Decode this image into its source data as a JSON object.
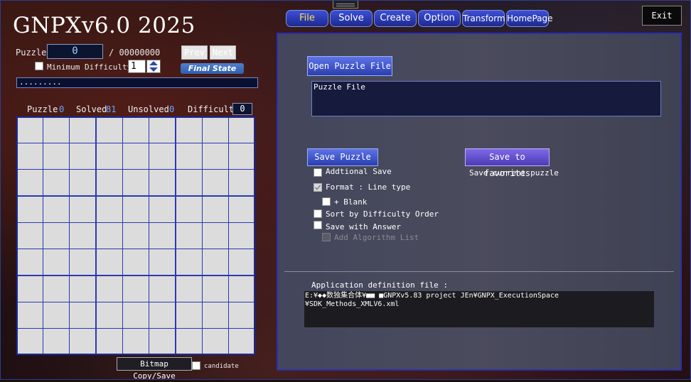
{
  "app": {
    "title": "GNPXv6.0 2025"
  },
  "menu": {
    "tabs": [
      "File",
      "Solve",
      "Create",
      "Option",
      "Transform",
      "HomePage"
    ],
    "exit_label": "Exit"
  },
  "left": {
    "puzzle_label": "Puzzle",
    "puzzle_number": "0",
    "puzzle_total": "/ 00000000",
    "prev_label": "Prev",
    "next_label": "Next",
    "min_difficulty_label": "Minimum Difficulty",
    "min_difficulty_value": "1",
    "final_state_label": "Final State",
    "progress_text": ".........",
    "stats": {
      "puzzle_label": "Puzzle",
      "puzzle_value": "0",
      "solved_label": "Solved",
      "solved_value": "81",
      "unsolved_label": "Unsolved",
      "unsolved_value": "0",
      "difficulty_label": "Difficulty",
      "difficulty_value": "0"
    },
    "bitmap_button": "Bitmap Copy/Save",
    "candidate_label": "candidate"
  },
  "file_panel": {
    "open_button": "Open Puzzle File",
    "puzzle_file_text": "Puzzle File",
    "save_button": "Save Puzzle",
    "favorites_button": "Save to favorites",
    "favorites_desc": "Save current puzzle",
    "options": [
      {
        "label": "Addtional Save",
        "checked": false,
        "disabled": false
      },
      {
        "label": "Format : Line type",
        "checked": true,
        "disabled": true
      },
      {
        "label": "+ Blank",
        "checked": false,
        "disabled": false
      },
      {
        "label": "Sort by Difficulty Order",
        "checked": false,
        "disabled": false
      },
      {
        "label": "Save with Answer",
        "checked": false,
        "disabled": false
      },
      {
        "label": "Add Algorithm List",
        "checked": false,
        "disabled": true
      }
    ],
    "app_def_label": "Application definition file :",
    "app_def_path_line1": "E:¥◆◆数独集合体¥■■ ■GNPXv5.83 project JEn¥GNPX_ExecutionSpace",
    "app_def_path_line2": "¥SDK_Methods_XMLV6.xml"
  }
}
